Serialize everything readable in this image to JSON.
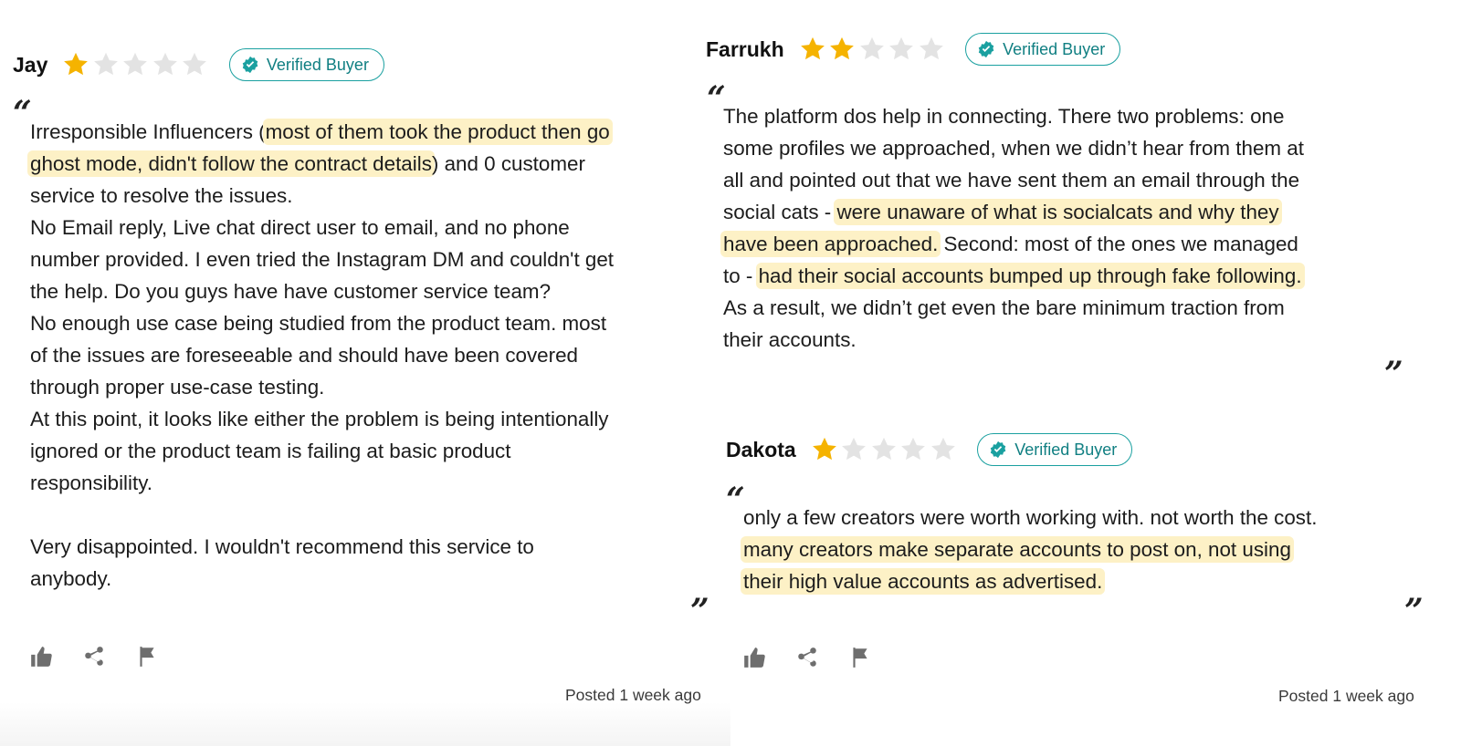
{
  "reviews": [
    {
      "name": "Jay",
      "rating": 1,
      "rating_max": 5,
      "badge": "Verified Buyer",
      "open_quote": "“",
      "close_quote": "”",
      "lines": [
        [
          {
            "t": "Irresponsible Influencers ("
          },
          {
            "t": "most of them took the product then go",
            "hl": true
          }
        ],
        [
          {
            "t": "ghost mode, didn't follow the contract details",
            "hl": true
          },
          {
            "t": ") and 0 customer"
          }
        ],
        [
          {
            "t": "service to resolve the issues."
          }
        ],
        [
          {
            "t": "No Email reply, Live chat direct user to email, and no phone"
          }
        ],
        [
          {
            "t": "number provided. I even tried the Instagram DM and couldn't get"
          }
        ],
        [
          {
            "t": "the help. Do you guys have have customer service team?"
          }
        ],
        [
          {
            "t": "No enough use case being studied from the product team. most"
          }
        ],
        [
          {
            "t": "of the issues are foreseeable and should have been covered"
          }
        ],
        [
          {
            "t": "through proper use-case testing."
          }
        ],
        [
          {
            "t": "At this point, it looks like either the problem is being intentionally"
          }
        ],
        [
          {
            "t": "ignored or the product team is failing at basic product"
          }
        ],
        [
          {
            "t": "responsibility."
          }
        ],
        [],
        [
          {
            "t": "Very disappointed. I wouldn't recommend this service to"
          }
        ],
        [
          {
            "t": "anybody."
          }
        ]
      ],
      "actions": [
        "thumbs-up-icon",
        "share-icon",
        "flag-icon"
      ],
      "posted": "Posted 1 week ago"
    },
    {
      "name": "Farrukh",
      "rating": 2,
      "rating_max": 5,
      "badge": "Verified Buyer",
      "open_quote": "“",
      "close_quote": "”",
      "lines": [
        [
          {
            "t": "The platform dos help in connecting. There two problems: one"
          }
        ],
        [
          {
            "t": "some profiles we approached, when we didn’t hear from them at"
          }
        ],
        [
          {
            "t": "all and pointed out that we have sent them an email through the"
          }
        ],
        [
          {
            "t": "social cats - "
          },
          {
            "t": "were unaware of what is socialcats and why they",
            "hl": true
          }
        ],
        [
          {
            "t": "have been approached.",
            "hl": true
          },
          {
            "t": " Second: most of the ones we managed"
          }
        ],
        [
          {
            "t": "to - "
          },
          {
            "t": "had their social accounts bumped up through fake following.",
            "hl": true
          }
        ],
        [
          {
            "t": "As a result, we didn’t get even the bare minimum traction from"
          }
        ],
        [
          {
            "t": "their accounts."
          }
        ]
      ]
    },
    {
      "name": "Dakota",
      "rating": 1,
      "rating_max": 5,
      "badge": "Verified Buyer",
      "open_quote": "“",
      "close_quote": "”",
      "lines": [
        [
          {
            "t": "only a few creators were worth working with. not worth the cost."
          }
        ],
        [
          {
            "t": "many creators make separate accounts to post on, not using",
            "hl": true
          }
        ],
        [
          {
            "t": "their high value accounts as advertised.",
            "hl": true
          }
        ]
      ],
      "actions": [
        "thumbs-up-icon",
        "share-icon",
        "flag-icon"
      ],
      "posted": "Posted 1 week ago"
    }
  ],
  "colors": {
    "star_filled": "#f5b300",
    "star_empty": "#e3e3e3",
    "badge_teal": "#1aa0a0",
    "highlight": "#fdf1c6"
  }
}
